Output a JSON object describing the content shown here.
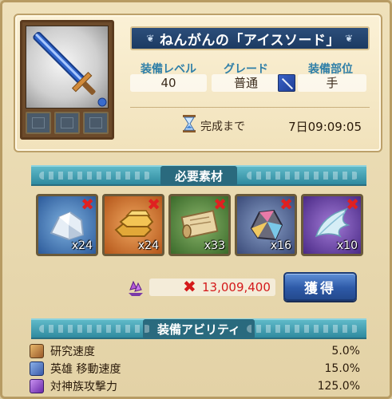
{
  "equipment": {
    "title": "ねんがんの「アイスソード」",
    "stats": [
      {
        "label": "装備レベル",
        "value": "40"
      },
      {
        "label": "グレード",
        "value": "普通"
      },
      {
        "label": "装備部位",
        "value": "手"
      }
    ],
    "completion": {
      "label": "完成まで",
      "time": "7日09:09:05"
    }
  },
  "materials_section": {
    "title": "必要素材",
    "items": [
      {
        "icon": "crystal-ore-icon",
        "quantity": "x24",
        "missing": true
      },
      {
        "icon": "gold-ingot-icon",
        "quantity": "x24",
        "missing": true
      },
      {
        "icon": "scroll-icon",
        "quantity": "x33",
        "missing": true
      },
      {
        "icon": "prism-crystal-icon",
        "quantity": "x16",
        "missing": true
      },
      {
        "icon": "feather-wings-icon",
        "quantity": "x10",
        "missing": true
      }
    ],
    "cost": "13,009,400",
    "acquire_label": "獲得"
  },
  "abilities_section": {
    "title": "装備アビリティ",
    "items": [
      {
        "name": "研究速度",
        "value": "5.0%",
        "icon": "research-book-icon"
      },
      {
        "name": "英雄 移動速度",
        "value": "15.0%",
        "icon": "hero-speed-icon"
      },
      {
        "name": "対神族攻撃力",
        "value": "125.0%",
        "icon": "divine-attack-icon"
      }
    ]
  },
  "colors": {
    "title_banner": "#1c3a62",
    "stat_label": "#2f7fa8",
    "section_banner": "#2f8a9f",
    "cost_text": "#d4191a",
    "acquire_button": "#2e5aa8"
  }
}
